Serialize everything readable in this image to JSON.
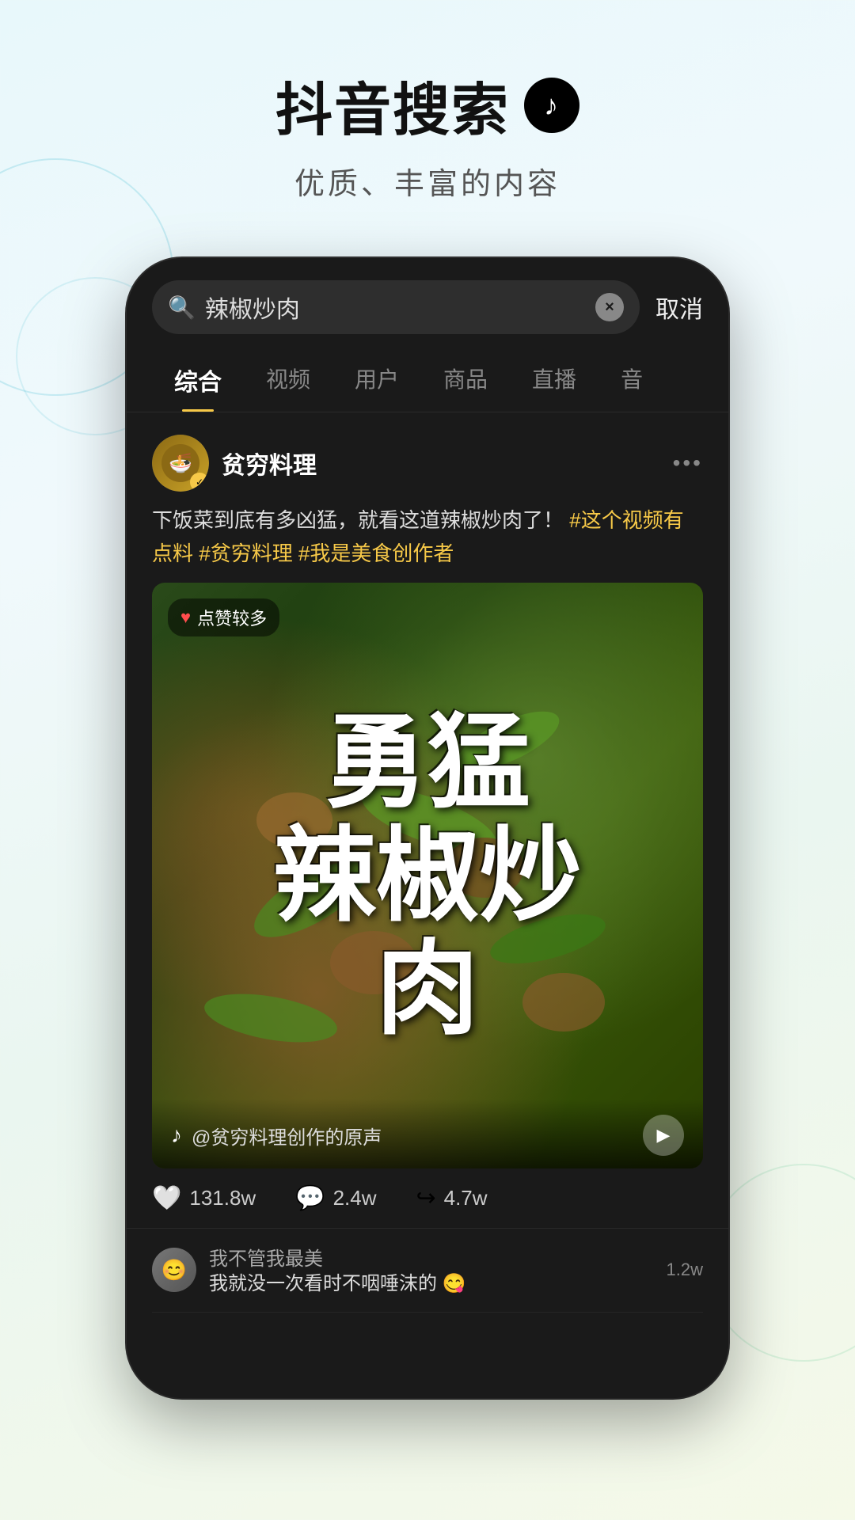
{
  "header": {
    "title": "抖音搜索",
    "logo_symbol": "♪",
    "subtitle": "优质、丰富的内容"
  },
  "phone": {
    "search_bar": {
      "search_text": "辣椒炒肉",
      "clear_icon": "×",
      "cancel_label": "取消"
    },
    "tabs": [
      {
        "label": "综合",
        "active": true
      },
      {
        "label": "视频",
        "active": false
      },
      {
        "label": "用户",
        "active": false
      },
      {
        "label": "商品",
        "active": false
      },
      {
        "label": "直播",
        "active": false
      },
      {
        "label": "音",
        "active": false
      }
    ],
    "post": {
      "username": "贫穷料理",
      "verified": true,
      "text_main": "下饭菜到底有多凶猛，就看这道辣椒炒肉了！",
      "hashtags": [
        "#这个视频有点料",
        "#贫穷料理",
        "#我是美食创作者"
      ],
      "video": {
        "badge": "点赞较多",
        "chinese_line1": "勇",
        "chinese_line2": "猛",
        "chinese_line3": "辣",
        "chinese_line4": "椒炒",
        "chinese_line5": "肉",
        "source_text": "@贫穷料理创作的原声"
      },
      "stats": {
        "likes": "131.8w",
        "comments": "2.4w",
        "shares": "4.7w"
      },
      "comments": [
        {
          "username": "我不管我最美",
          "text": "我就没一次看时不咽唾沫的 😋",
          "likes": "1.2w"
        }
      ]
    }
  }
}
